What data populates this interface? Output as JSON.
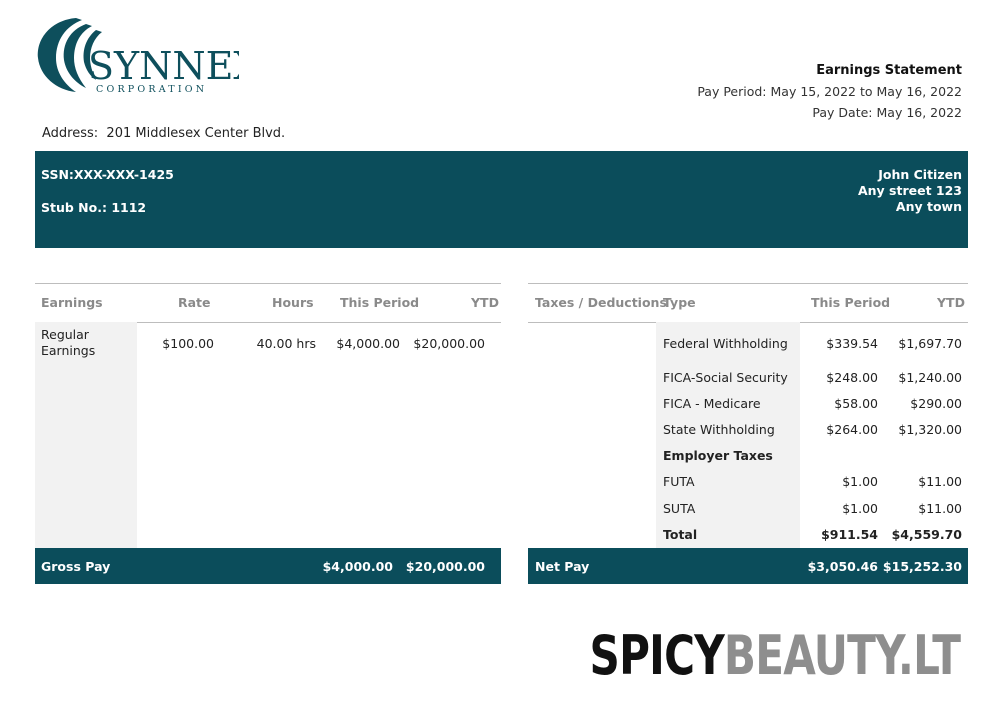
{
  "company": {
    "name": "SYNNEX",
    "sub": "CORPORATION"
  },
  "statement": {
    "title": "Earnings Statement",
    "pay_period_label": "Pay Period:",
    "pay_period_start": "May 15, 2022",
    "pay_period_to": "to",
    "pay_period_end": "May 16, 2022",
    "pay_date_label": "Pay Date:",
    "pay_date": "May 16, 2022"
  },
  "address": {
    "label": "Address:",
    "value": "201 Middlesex Center Blvd."
  },
  "employee": {
    "ssn_label": "SSN:",
    "ssn": "XXX-XXX-1425",
    "stub_label": "Stub No.:",
    "stub": "1112",
    "name": "John Citizen",
    "street": "Any street 123",
    "town": "Any town"
  },
  "earnings": {
    "headers": [
      "Earnings",
      "Rate",
      "Hours",
      "This Period",
      "YTD"
    ],
    "rows": [
      {
        "type_line1": "Regular",
        "type_line2": "Earnings",
        "rate": "$100.00",
        "hours": "40.00 hrs",
        "period": "$4,000.00",
        "ytd": "$20,000.00"
      }
    ],
    "footer_label": "Gross Pay",
    "footer_period": "$4,000.00",
    "footer_ytd": "$20,000.00"
  },
  "taxes": {
    "headers": [
      "Taxes / Deductions",
      "Type",
      "This Period",
      "YTD"
    ],
    "rows": [
      {
        "type": "Federal Withholding",
        "period": "$339.54",
        "ytd": "$1,697.70"
      },
      {
        "type": "FICA-Social Security",
        "period": "$248.00",
        "ytd": "$1,240.00"
      },
      {
        "type": "FICA - Medicare",
        "period": "$58.00",
        "ytd": "$290.00"
      },
      {
        "type": "State Withholding",
        "period": "$264.00",
        "ytd": "$1,320.00"
      },
      {
        "type": "Employer Taxes",
        "period": "",
        "ytd": ""
      },
      {
        "type": "FUTA",
        "period": "$1.00",
        "ytd": "$11.00"
      },
      {
        "type": "SUTA",
        "period": "$1.00",
        "ytd": "$11.00"
      },
      {
        "type": "Total",
        "period": "$911.54",
        "ytd": "$4,559.70"
      }
    ],
    "footer_label": "Net Pay",
    "footer_period": "$3,050.46",
    "footer_ytd": "$15,252.30"
  },
  "watermark": {
    "part1": "SPICY",
    "part2": "BEAUTY.LT"
  },
  "colors": {
    "banner": "#0b4d5b",
    "logo": "#0e4f5c",
    "shade": "#f2f2f2"
  }
}
